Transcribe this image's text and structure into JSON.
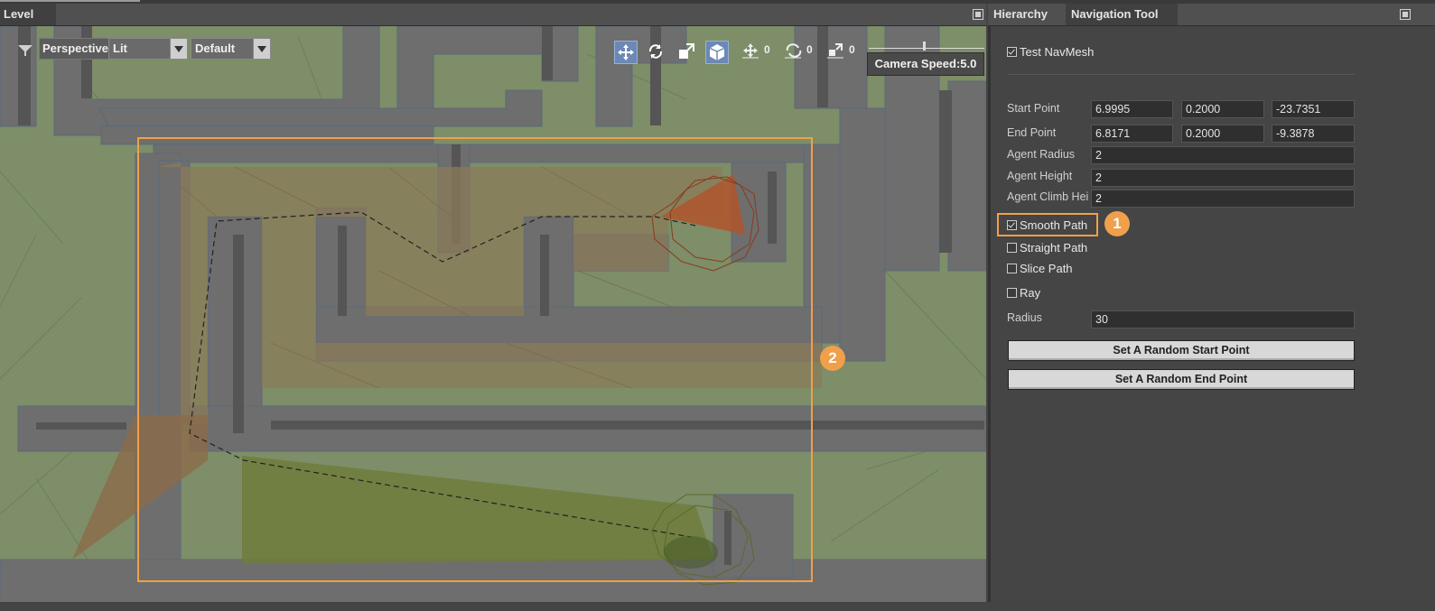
{
  "level_panel": {
    "title": "Level",
    "toolbar": {
      "view_mode": "Perspective",
      "shading": "Lit",
      "preset": "Default",
      "move_count": "0",
      "rotate_count": "0",
      "scale_count": "0",
      "camera_speed": "Camera Speed:5.0"
    },
    "callout_2": "2"
  },
  "right_panel": {
    "tabs": [
      "Hierarchy",
      "Navigation Tool"
    ],
    "active_tab": "Navigation Tool",
    "test_navmesh": {
      "label": "Test NavMesh",
      "checked": true
    },
    "start_point": {
      "label": "Start Point",
      "x": "6.9995",
      "y": "0.2000",
      "z": "-23.7351"
    },
    "end_point": {
      "label": "End Point",
      "x": "6.8171",
      "y": "0.2000",
      "z": "-9.3878"
    },
    "agent_radius": {
      "label": "Agent Radius",
      "value": "2"
    },
    "agent_height": {
      "label": "Agent Height",
      "value": "2"
    },
    "agent_climb": {
      "label": "Agent Climb Hei",
      "value": "2"
    },
    "smooth_path": {
      "label": "Smooth Path",
      "checked": true
    },
    "straight_path": {
      "label": "Straight Path",
      "checked": false
    },
    "slice_path": {
      "label": "Slice Path",
      "checked": false
    },
    "ray": {
      "label": "Ray",
      "checked": false
    },
    "radius": {
      "label": "Radius",
      "value": "30"
    },
    "random_start_btn": "Set A Random Start Point",
    "random_end_btn": "Set A Random End Point",
    "callout_1": "1"
  },
  "colors": {
    "accent": "#f0a04a",
    "navmesh_green": "#7d8e68",
    "wall_gray": "#6c6c6c",
    "path_region_brown": "#8b7b5a",
    "start_marker": "#b0552c",
    "end_region": "#6f7d3c"
  }
}
